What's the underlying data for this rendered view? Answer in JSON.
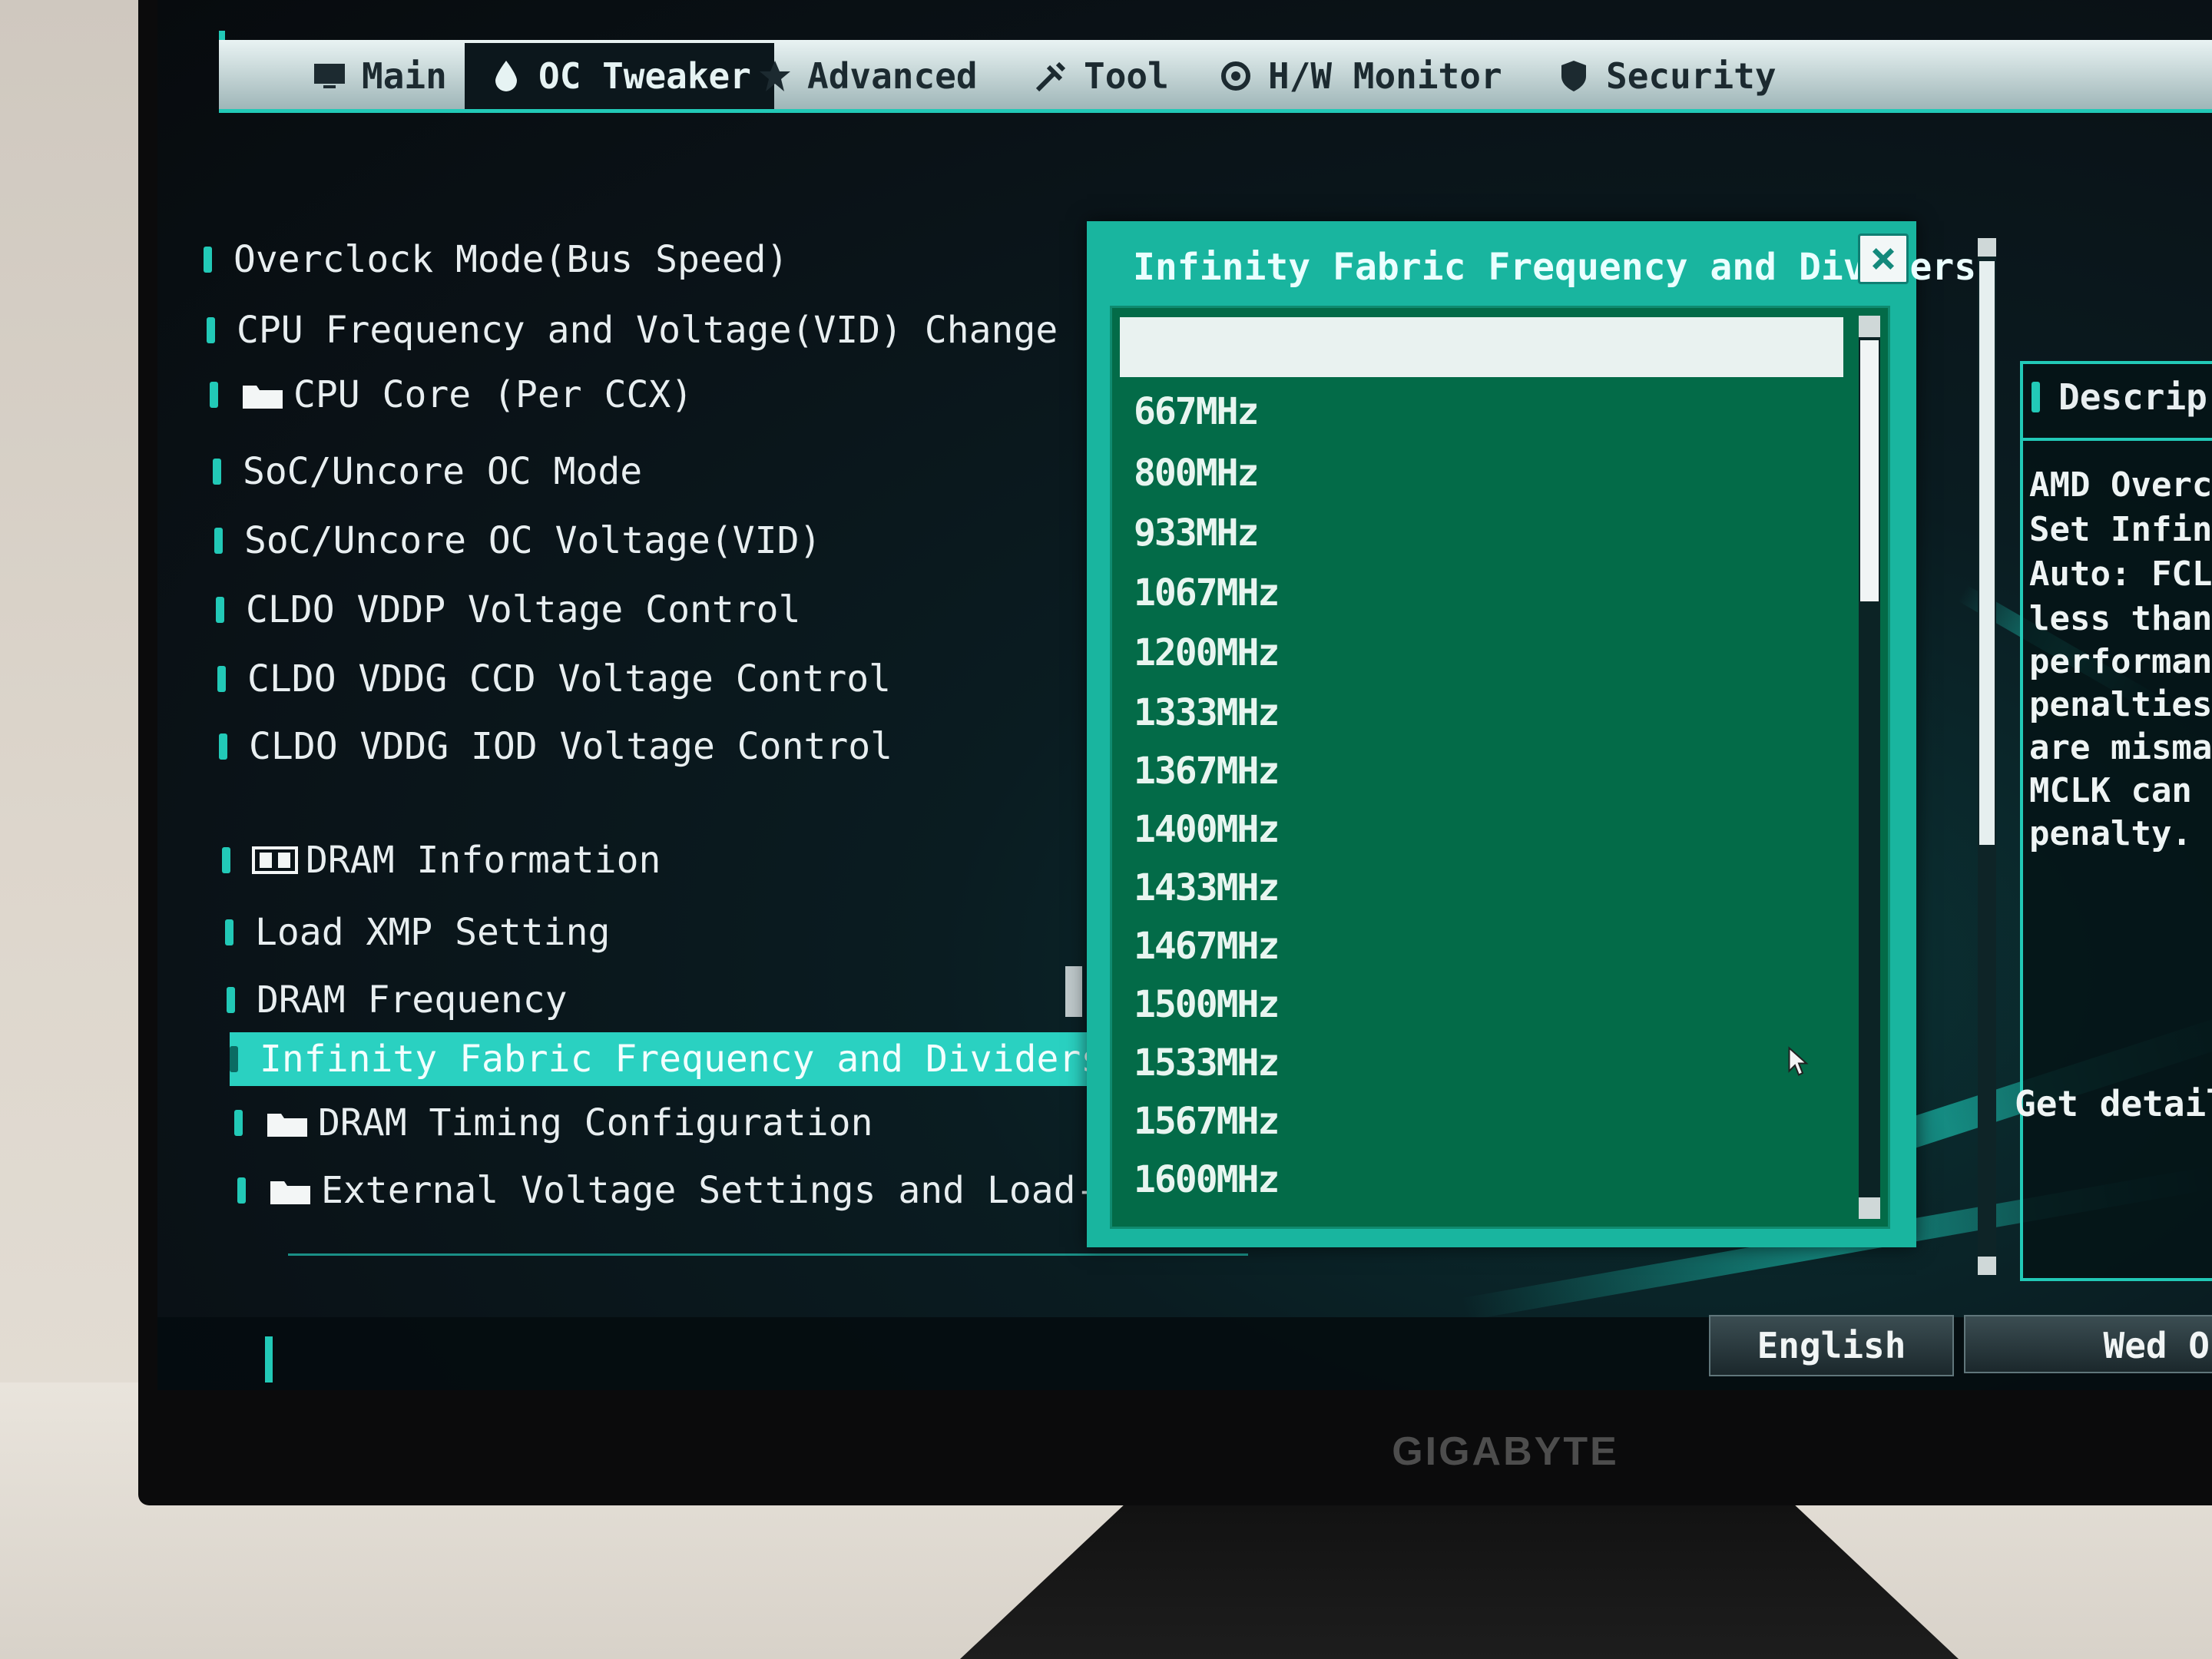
{
  "tabs": [
    {
      "label": "Main",
      "icon": "monitor-icon",
      "active": false
    },
    {
      "label": "OC Tweaker",
      "icon": "droplet-icon",
      "active": true
    },
    {
      "label": "Advanced",
      "icon": "star-icon",
      "active": false
    },
    {
      "label": "Tool",
      "icon": "tools-icon",
      "active": false
    },
    {
      "label": "H/W Monitor",
      "icon": "gear-icon",
      "active": false
    },
    {
      "label": "Security",
      "icon": "shield-icon",
      "active": false
    }
  ],
  "menu": {
    "items": [
      {
        "label": "Overclock Mode(Bus Speed)"
      },
      {
        "label": "CPU Frequency and Voltage(VID) Change"
      },
      {
        "label": "CPU Core (Per CCX)",
        "folder": true
      },
      {
        "label": "SoC/Uncore OC Mode"
      },
      {
        "label": "SoC/Uncore OC Voltage(VID)"
      },
      {
        "label": "CLDO VDDP Voltage Control"
      },
      {
        "label": "CLDO VDDG CCD Voltage Control"
      },
      {
        "label": "CLDO VDDG IOD Voltage Control"
      },
      {
        "label": "DRAM Information",
        "icon": "memory-icon"
      },
      {
        "label": "Load XMP Setting"
      },
      {
        "label": "DRAM Frequency"
      },
      {
        "label": "Infinity Fabric Frequency and Dividers",
        "selected": true
      },
      {
        "label": "DRAM Timing Configuration",
        "folder": true
      },
      {
        "label": "External Voltage Settings and Load-Line Ca",
        "folder": true
      }
    ]
  },
  "popup": {
    "title": "Infinity Fabric Frequency and Dividers",
    "close_icon": "close-icon",
    "selected_option": "",
    "options": [
      "667MHz",
      "800MHz",
      "933MHz",
      "1067MHz",
      "1200MHz",
      "1333MHz",
      "1367MHz",
      "1400MHz",
      "1433MHz",
      "1467MHz",
      "1500MHz",
      "1533MHz",
      "1567MHz",
      "1600MHz"
    ]
  },
  "description": {
    "header": "Descrip",
    "lines": [
      "AMD Overcl",
      "Set Infini",
      "Auto: FCLK",
      "less than",
      "performanc",
      "penalties",
      "are mismat",
      "MCLK can n",
      "penalty."
    ],
    "get_details": "Get details"
  },
  "footer": {
    "language": "English",
    "date": "Wed O"
  },
  "monitor": {
    "brand": "GIGABYTE"
  },
  "colors": {
    "accent": "#22c9b7",
    "popup_bg": "#036b48",
    "screen_bg": "#0a1217"
  }
}
